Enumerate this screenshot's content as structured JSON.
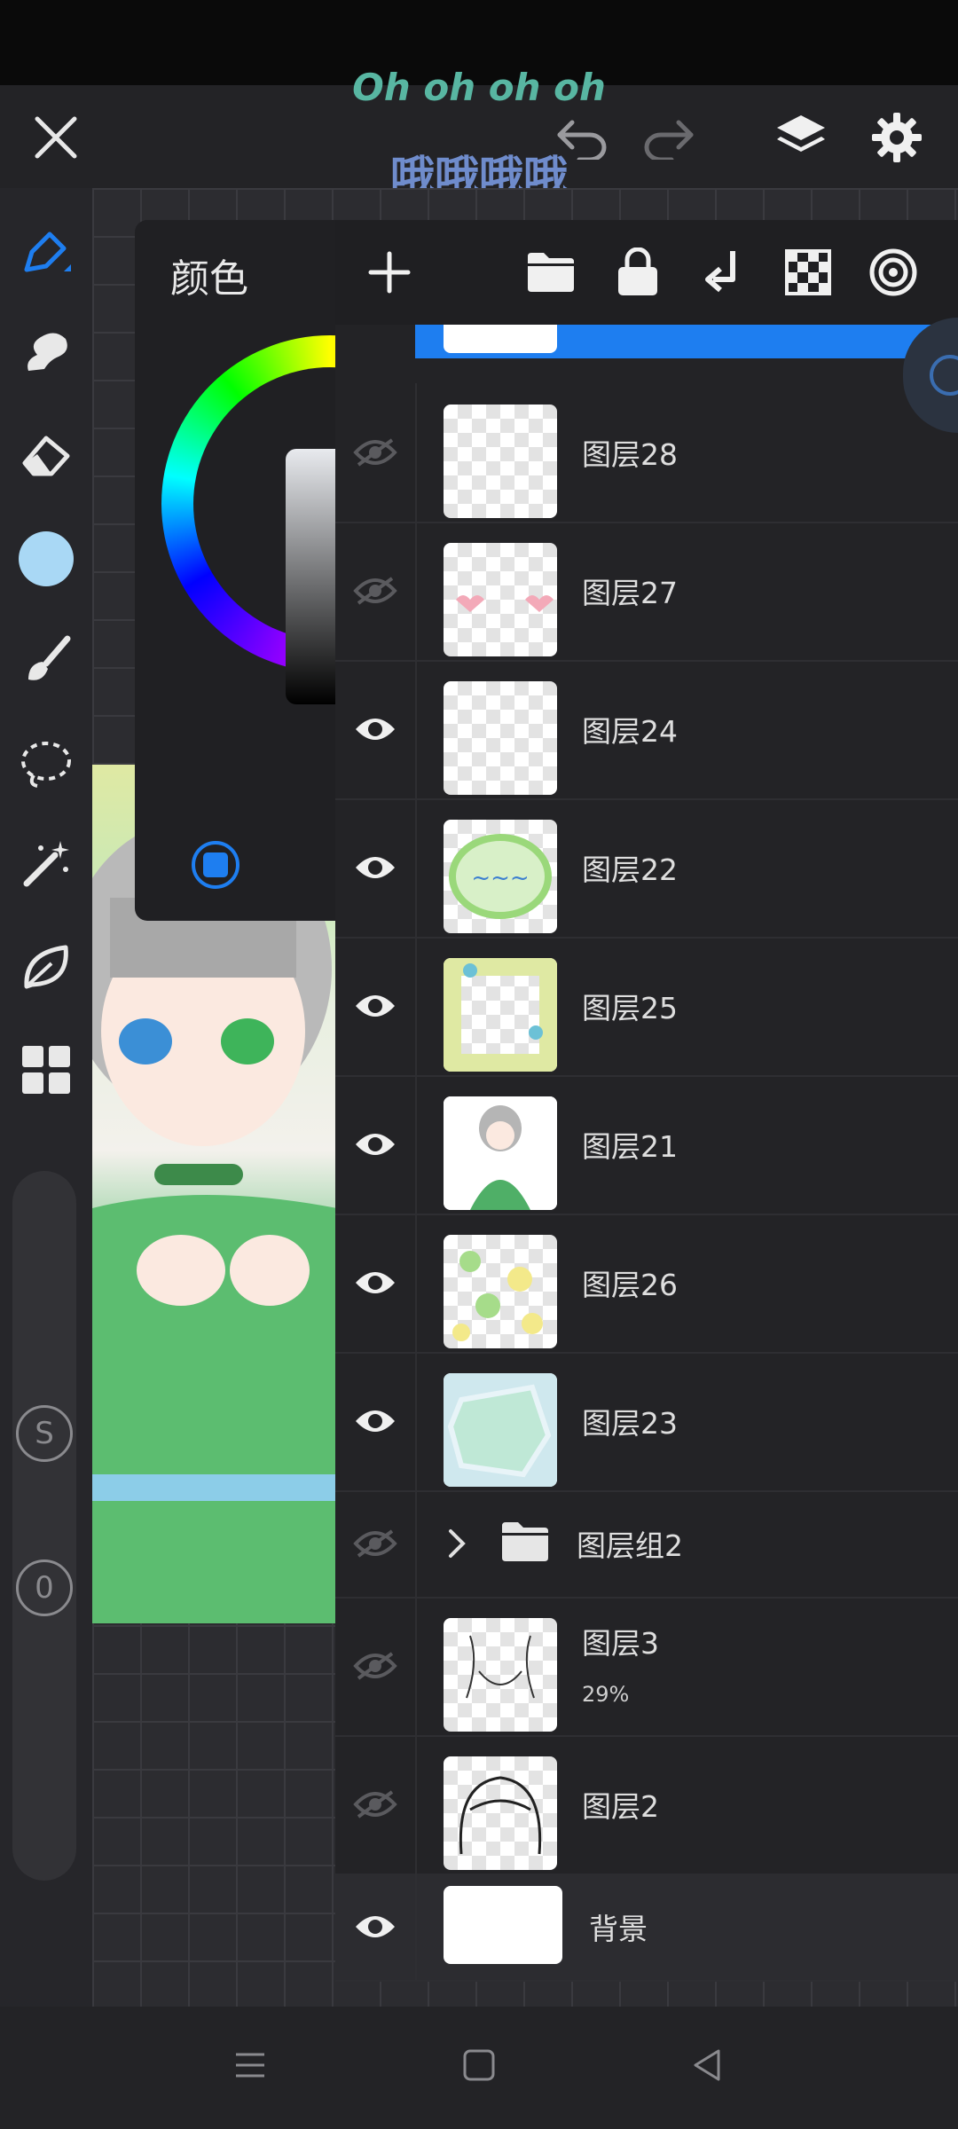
{
  "lyrics": {
    "line1": "Oh oh oh oh",
    "line2": "哦哦哦哦"
  },
  "top_bar": {
    "close_icon": "close-icon",
    "undo_icon": "undo-icon",
    "redo_icon": "redo-icon",
    "layers_icon": "layers-icon",
    "settings_icon": "gear-icon"
  },
  "color_panel": {
    "title": "颜色"
  },
  "colors": {
    "accent": "#1e7ef0",
    "selected_color": "#a9d8f5",
    "selection_bar": "#1e7ef0"
  },
  "left_tools": [
    "pen-icon",
    "smudge-icon",
    "eraser-icon",
    "color-swatch",
    "brush-icon",
    "lasso-icon",
    "magic-wand-icon",
    "leaf-icon",
    "grid-icon"
  ],
  "slider_buttons": {
    "s_label": "S",
    "zero_label": "0"
  },
  "layers": [
    {
      "name": "图层28",
      "visible": false
    },
    {
      "name": "图层27",
      "visible": false
    },
    {
      "name": "图层24",
      "visible": true
    },
    {
      "name": "图层22",
      "visible": true
    },
    {
      "name": "图层25",
      "visible": true
    },
    {
      "name": "图层21",
      "visible": true
    },
    {
      "name": "图层26",
      "visible": true
    },
    {
      "name": "图层23",
      "visible": true
    },
    {
      "name": "图层组2",
      "visible": false,
      "group": true
    },
    {
      "name": "图层3",
      "visible": false,
      "opacity": "29%"
    },
    {
      "name": "图层2",
      "visible": false
    },
    {
      "name": "背景",
      "visible": true
    }
  ]
}
